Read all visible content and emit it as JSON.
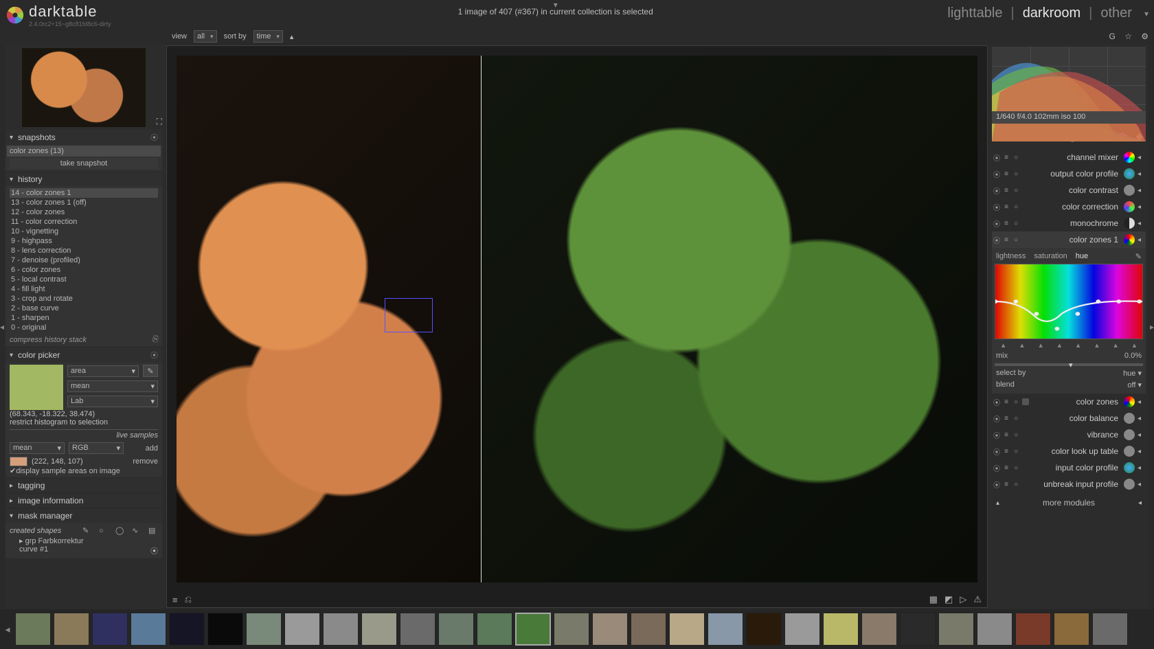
{
  "app": {
    "name": "darktable",
    "version": "2.4.0rc2+15~g8c81fd8c6-dirty"
  },
  "status": "1 image of 407 (#367) in current collection is selected",
  "modes": {
    "lighttable": "lighttable",
    "darkroom": "darkroom",
    "other": "other",
    "sep": "|"
  },
  "viewbar": {
    "view_label": "view",
    "view_value": "all",
    "sort_label": "sort by",
    "sort_value": "time"
  },
  "snapshots": {
    "title": "snapshots",
    "item": "color zones (13)",
    "button": "take snapshot"
  },
  "history": {
    "title": "history",
    "items": [
      "14 - color zones 1",
      "13 - color zones 1 (off)",
      "12 - color zones",
      "11 - color correction",
      "10 - vignetting",
      "9 - highpass",
      "8 - lens correction",
      "7 - denoise (profiled)",
      "6 - color zones",
      "5 - local contrast",
      "4 - fill light",
      "3 - crop and rotate",
      "2 - base curve",
      "1 - sharpen",
      "0 - original"
    ],
    "compress": "compress history stack"
  },
  "color_picker": {
    "title": "color picker",
    "mode": "area",
    "stat": "mean",
    "space": "Lab",
    "lab": "(68.343, -18.322, 38.474)",
    "restrict": "restrict histogram to selection",
    "live": "live samples",
    "sample_mode": "mean",
    "sample_space": "RGB",
    "add": "add",
    "rgb": "(222, 148, 107)",
    "remove": "remove",
    "display": "display sample areas on image",
    "swatch_color": "#a3b862",
    "sample_swatch": "#d49f7a"
  },
  "tagging": {
    "title": "tagging"
  },
  "image_information": {
    "title": "image information"
  },
  "mask": {
    "title": "mask manager",
    "created": "created shapes",
    "grp": "grp Farbkorrektur",
    "curve": "curve #1"
  },
  "exif": "1/640 f/4.0 102mm iso 100",
  "module_groups": [
    "power",
    "star",
    "circle",
    "half",
    "rainbow",
    "refresh",
    "grid"
  ],
  "modules": {
    "channel_mixer": "channel mixer",
    "output_color_profile": "output color profile",
    "color_contrast": "color contrast",
    "color_correction": "color correction",
    "monochrome": "monochrome",
    "color_zones_1": "color zones 1",
    "color_zones": "color zones",
    "color_balance": "color balance",
    "vibrance": "vibrance",
    "color_lut": "color look up table",
    "input_color_profile": "input color profile",
    "unbreak": "unbreak input profile"
  },
  "colorzones": {
    "tabs": {
      "lightness": "lightness",
      "saturation": "saturation",
      "hue": "hue"
    },
    "mix_label": "mix",
    "mix_value": "0.0%",
    "select_label": "select by",
    "select_value": "hue",
    "blend_label": "blend",
    "blend_value": "off"
  },
  "more_modules": "more modules",
  "filmstrip_count": 29
}
